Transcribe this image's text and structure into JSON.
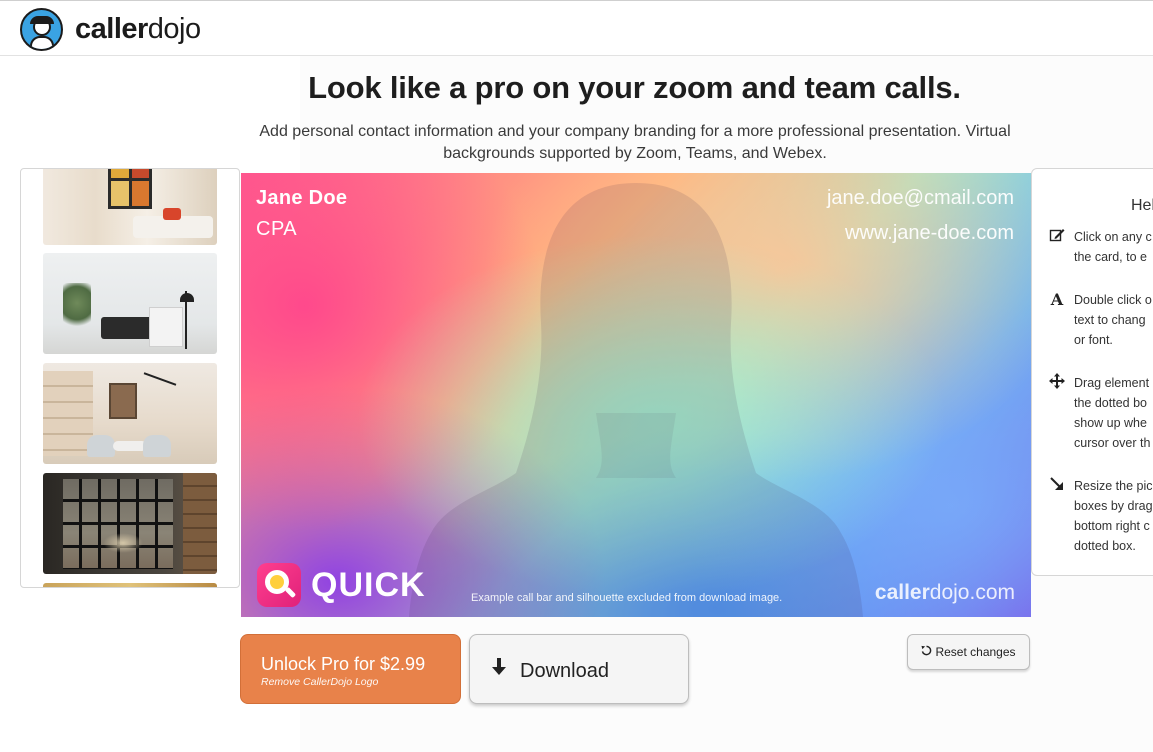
{
  "header": {
    "brand_bold": "caller",
    "brand_light": "dojo"
  },
  "hero": {
    "title": "Look like a pro on your zoom and team calls.",
    "subtitle": "Add personal contact information and your company branding for a more professional presentation. Virtual backgrounds supported by Zoom, Teams, and Webex."
  },
  "card": {
    "name": "Jane Doe",
    "title": "CPA",
    "email": "jane.doe@cmail.com",
    "website": "www.jane-doe.com",
    "logo_text": "QUICK",
    "call_bar_note": "Example call bar and silhouette excluded from download image.",
    "brand_bold": "caller",
    "brand_light": "dojo.com"
  },
  "help": {
    "title": "Hel",
    "items": [
      {
        "icon": "edit-icon",
        "lines": [
          "Click on any c",
          "the card, to e"
        ]
      },
      {
        "icon": "font-icon",
        "lines": [
          "Double click o",
          "text to chang",
          "or font."
        ]
      },
      {
        "icon": "move-icon",
        "lines": [
          "Drag element",
          "the dotted bo",
          "show up whe",
          "cursor over th"
        ]
      },
      {
        "icon": "resize-icon",
        "lines": [
          "Resize the pic",
          "boxes by drag",
          "bottom right c",
          "dotted box."
        ]
      }
    ]
  },
  "actions": {
    "pro_label": "Unlock Pro for $2.99",
    "pro_sublabel": "Remove CallerDojo Logo",
    "download_label": "Download",
    "reset_label": "Reset changes"
  },
  "colors": {
    "pro_button": "#e8824a",
    "brand_blue": "#3aa3e3"
  }
}
